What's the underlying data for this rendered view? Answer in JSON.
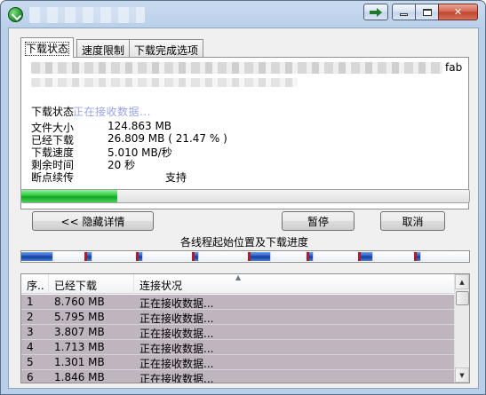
{
  "window": {
    "title": "",
    "controls": {
      "minimize": "",
      "maximize": "",
      "close": "✕"
    }
  },
  "tabs": [
    {
      "label": "下载状态",
      "active": true
    },
    {
      "label": "速度限制",
      "active": false
    },
    {
      "label": "下载完成选项",
      "active": false
    }
  ],
  "status": {
    "url_suffix": "fab",
    "action_label": "下载状态",
    "action_value": "正在接收数据...",
    "rows": [
      {
        "label": "文件大小",
        "value": "124.863  MB"
      },
      {
        "label": "已经下载",
        "value": "26.809  MB  ( 21.47 % )"
      },
      {
        "label": "下载速度",
        "value": "5.010  MB/秒"
      },
      {
        "label": "剩余时间",
        "value": "20 秒"
      },
      {
        "label": "断点续传",
        "value": "支持"
      }
    ]
  },
  "progress": {
    "percent": 21.47
  },
  "buttons": {
    "hide_details": "<< 隐藏详情",
    "pause": "暂停",
    "cancel": "取消"
  },
  "threads_caption": "各线程起始位置及下载进度",
  "segments": [
    {
      "start": 0.0,
      "done": 0.07
    },
    {
      "start": 0.145,
      "done": 0.012
    },
    {
      "start": 0.26,
      "done": 0.01
    },
    {
      "start": 0.385,
      "done": 0.01
    },
    {
      "start": 0.51,
      "done": 0.045
    },
    {
      "start": 0.64,
      "done": 0.01
    },
    {
      "start": 0.755,
      "done": 0.028
    },
    {
      "start": 0.88,
      "done": 0.01
    }
  ],
  "connections": {
    "columns": [
      "序..",
      "已经下载",
      "连接状况"
    ],
    "rows": [
      {
        "id": "1",
        "downloaded": "8.760  MB",
        "status": "正在接收数据..."
      },
      {
        "id": "2",
        "downloaded": "5.795  MB",
        "status": "正在接收数据..."
      },
      {
        "id": "3",
        "downloaded": "3.807  MB",
        "status": "正在接收数据..."
      },
      {
        "id": "4",
        "downloaded": "1.713  MB",
        "status": "正在接收数据..."
      },
      {
        "id": "5",
        "downloaded": "1.301  MB",
        "status": "正在接收数据..."
      },
      {
        "id": "6",
        "downloaded": "1.846  MB",
        "status": "正在接收数据..."
      }
    ]
  },
  "colors": {
    "progress_green": "#2fc83f",
    "segment_blue": "#1b4fb7",
    "segment_marker": "#b01c2c",
    "list_row_bg": "#bfb5bf"
  }
}
